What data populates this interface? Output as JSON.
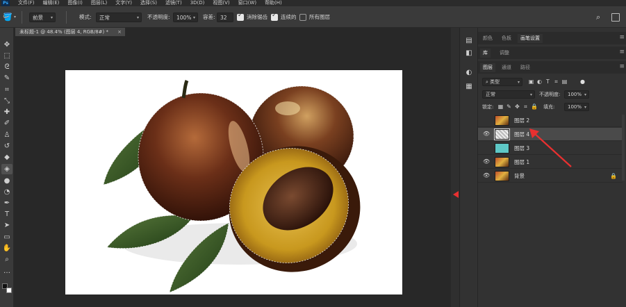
{
  "menubar": {
    "logo": "Ps",
    "items": [
      "文件(F)",
      "编辑(E)",
      "图像(I)",
      "图层(L)",
      "文字(Y)",
      "选择(S)",
      "滤镜(T)",
      "3D(D)",
      "视图(V)",
      "窗口(W)",
      "帮助(H)"
    ]
  },
  "options": {
    "tool_preset": "前景",
    "mode_label": "模式:",
    "mode_value": "正常",
    "opacity_label": "不透明度:",
    "opacity_value": "100%",
    "tolerance_label": "容差:",
    "tolerance_value": "32",
    "antialias_label": "消除锯齿",
    "contiguous_label": "连续的",
    "all_layers_label": "所有图层",
    "antialias_checked": true,
    "contiguous_checked": true,
    "all_layers_checked": false
  },
  "document": {
    "tab_title": "未标题-1 @ 48.4% (图层 4, RGB/8#) *",
    "close": "×"
  },
  "panels": {
    "top_tabs": [
      "颜色",
      "色板",
      "画笔设置"
    ],
    "mid_tabs": [
      "库",
      "调整"
    ],
    "layer_tabs": [
      "图层",
      "通道",
      "路径"
    ],
    "menu_icon": "≡",
    "filter_kind": "类型",
    "blend_mode": "正常",
    "opacity_label": "不透明度:",
    "opacity_value": "100%",
    "lock_label": "锁定:",
    "fill_label": "填充:",
    "fill_value": "100%"
  },
  "layers": [
    {
      "name": "图层 2",
      "visible": false,
      "selected": false,
      "thumb": "fruit"
    },
    {
      "name": "图层 4",
      "visible": true,
      "selected": true,
      "thumb": "selection"
    },
    {
      "name": "图层 3",
      "visible": false,
      "selected": false,
      "thumb": "teal"
    },
    {
      "name": "图层 1",
      "visible": true,
      "selected": false,
      "thumb": "fruit"
    },
    {
      "name": "背景",
      "visible": true,
      "selected": false,
      "thumb": "fruit",
      "locked": true
    }
  ],
  "colors": {
    "accent_red": "#e83030",
    "teal": "#5ec8c6",
    "ps_blue": "#31a8ff"
  },
  "icons": {
    "tools": [
      "move-icon",
      "marquee-icon",
      "lasso-icon",
      "quick-select-icon",
      "crop-icon",
      "eyedropper-icon",
      "healing-icon",
      "brush-icon",
      "stamp-icon",
      "history-brush-icon",
      "eraser-icon",
      "paint-bucket-icon",
      "blur-icon",
      "dodge-icon",
      "pen-icon",
      "type-icon",
      "path-select-icon",
      "shape-icon",
      "hand-icon",
      "zoom-icon",
      "more-icon"
    ]
  }
}
